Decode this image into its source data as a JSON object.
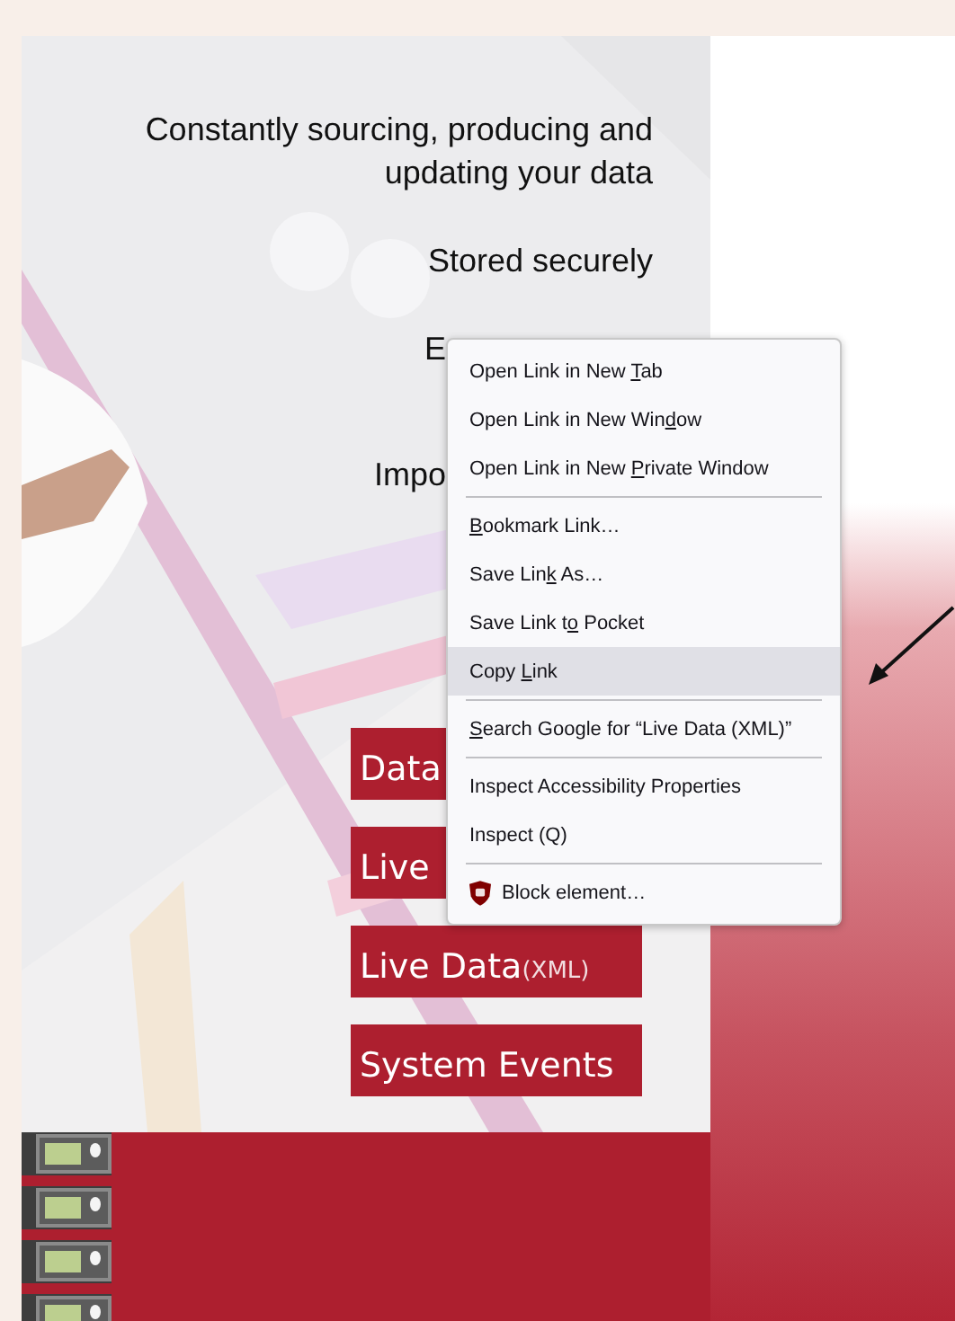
{
  "taglines": [
    {
      "kind": "full",
      "text": "Constantly sourcing, producing and updating your data"
    },
    {
      "kind": "full",
      "text": "Stored securely"
    },
    {
      "kind": "covered",
      "text": "E"
    },
    {
      "kind": "covered",
      "text": "Impo"
    }
  ],
  "links": [
    {
      "label": "Data"
    },
    {
      "label": "Live"
    },
    {
      "label": "Live Data",
      "note": "(XML)"
    },
    {
      "label": "System Events"
    }
  ],
  "context_menu": [
    {
      "kind": "item",
      "selected": false,
      "pre": "Open Link in New ",
      "key": "T",
      "post": "ab"
    },
    {
      "kind": "item",
      "selected": false,
      "pre": "Open Link in New Win",
      "key": "d",
      "post": "ow"
    },
    {
      "kind": "item",
      "selected": false,
      "pre": "Open Link in New ",
      "key": "P",
      "post": "rivate Window"
    },
    {
      "kind": "separator"
    },
    {
      "kind": "item",
      "selected": false,
      "key": "B",
      "post": "ookmark Link…"
    },
    {
      "kind": "item",
      "selected": false,
      "pre": "Save Lin",
      "key": "k",
      "post": " As…"
    },
    {
      "kind": "item",
      "selected": false,
      "pre": "Save Link t",
      "key": "o",
      "post": " Pocket"
    },
    {
      "kind": "item",
      "selected": true,
      "pre": "Copy ",
      "key": "L",
      "post": "ink"
    },
    {
      "kind": "separator"
    },
    {
      "kind": "item",
      "selected": false,
      "key": "S",
      "post": "earch Google for “Live Data (XML)”"
    },
    {
      "kind": "separator"
    },
    {
      "kind": "item",
      "selected": false,
      "pre": "Inspect Accessibility Properties"
    },
    {
      "kind": "item",
      "selected": false,
      "pre": "Inspect (Q)"
    },
    {
      "kind": "separator"
    },
    {
      "kind": "extension",
      "selected": false,
      "pre": "Block element…"
    }
  ]
}
